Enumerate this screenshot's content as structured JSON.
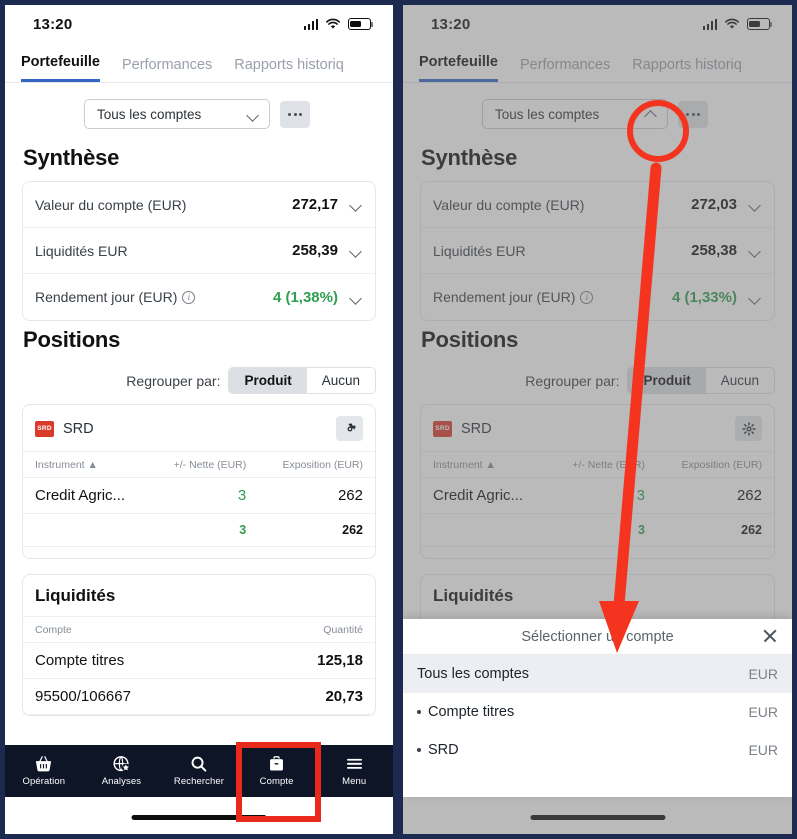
{
  "colors": {
    "accent_blue": "#3067c4",
    "nav_dark": "#0d1526",
    "green": "#2f9e4f",
    "annotation_red": "#f5341f",
    "srd_red": "#d93b2b",
    "frame_navy": "#1b2a4e"
  },
  "status_bar": {
    "time": "13:20",
    "icons": [
      "signal-icon",
      "wifi-icon",
      "battery-icon"
    ]
  },
  "tabs": [
    {
      "label": "Portefeuille",
      "active": true
    },
    {
      "label": "Performances",
      "active": false
    },
    {
      "label": "Rapports historiq",
      "active": false
    }
  ],
  "account_selector": {
    "value": "Tous les comptes",
    "chevron_left": "chevron-down-icon",
    "chevron_right": "chevron-up-icon",
    "more_label": "..."
  },
  "left": {
    "synthese": {
      "title": "Synthèse",
      "rows": [
        {
          "label": "Valeur du compte (EUR)",
          "value": "272,17",
          "green": false,
          "info": false
        },
        {
          "label": "Liquidités EUR",
          "value": "258,39",
          "green": false,
          "info": false
        },
        {
          "label": "Rendement jour (EUR)",
          "value": "4 (1,38%)",
          "green": true,
          "info": true
        }
      ]
    },
    "positions": {
      "title": "Positions",
      "group_label": "Regrouper par:",
      "group_options": [
        {
          "label": "Produit",
          "selected": true
        },
        {
          "label": "Aucun",
          "selected": false
        }
      ],
      "product": {
        "name": "SRD",
        "logo_text": "SRD"
      },
      "columns": [
        "Instrument",
        "+/- Nette (EUR)",
        "Exposition (EUR)"
      ],
      "sort_indicator": "▲",
      "rows": [
        {
          "instrument": "Credit Agric...",
          "net": "3",
          "exposure": "262"
        }
      ],
      "total": {
        "instrument": "",
        "net": "3",
        "exposure": "262"
      }
    },
    "liquidites": {
      "title": "Liquidités",
      "columns": [
        "Compte",
        "Quantité"
      ],
      "rows": [
        {
          "account": "Compte titres",
          "qty": "125,18"
        },
        {
          "account": "95500/106667",
          "qty": "20,73"
        }
      ]
    }
  },
  "right": {
    "synthese": {
      "title": "Synthèse",
      "rows": [
        {
          "label": "Valeur du compte (EUR)",
          "value": "272,03",
          "green": false,
          "info": false
        },
        {
          "label": "Liquidités EUR",
          "value": "258,38",
          "green": false,
          "info": false
        },
        {
          "label": "Rendement jour (EUR)",
          "value": "4 (1,33%)",
          "green": true,
          "info": true
        }
      ]
    },
    "positions": {
      "title": "Positions",
      "group_label": "Regrouper par:",
      "group_options": [
        {
          "label": "Produit",
          "selected": true
        },
        {
          "label": "Aucun",
          "selected": false
        }
      ],
      "product": {
        "name": "SRD",
        "logo_text": "SRD"
      },
      "columns": [
        "Instrument",
        "+/- Nette (EUR)",
        "Exposition (EUR)"
      ],
      "sort_indicator": "▲",
      "rows": [
        {
          "instrument": "Credit Agric...",
          "net": "3",
          "exposure": "262"
        }
      ],
      "total": {
        "instrument": "",
        "net": "3",
        "exposure": "262"
      }
    },
    "liquidites": {
      "title": "Liquidités"
    },
    "sheet": {
      "title": "Sélectionner un compte",
      "close_icon": "close-icon",
      "rows": [
        {
          "label": "Tous les comptes",
          "currency": "EUR",
          "selected": true,
          "bullet": false
        },
        {
          "label": "Compte titres",
          "currency": "EUR",
          "selected": false,
          "bullet": true
        },
        {
          "label": "SRD",
          "currency": "EUR",
          "selected": false,
          "bullet": true
        }
      ]
    }
  },
  "bottom_nav": [
    {
      "label": "Opération",
      "icon": "basket-icon",
      "active": false
    },
    {
      "label": "Analyses",
      "icon": "globe-star-icon",
      "active": false
    },
    {
      "label": "Rechercher",
      "icon": "search-icon",
      "active": false
    },
    {
      "label": "Compte",
      "icon": "briefcase-icon",
      "active": true
    },
    {
      "label": "Menu",
      "icon": "hamburger-icon",
      "active": false
    }
  ],
  "annotations": {
    "left_highlight_target": "Compte",
    "right_circle_target": "chevron-up-icon",
    "right_arrow_target": "Sélectionner un compte"
  }
}
